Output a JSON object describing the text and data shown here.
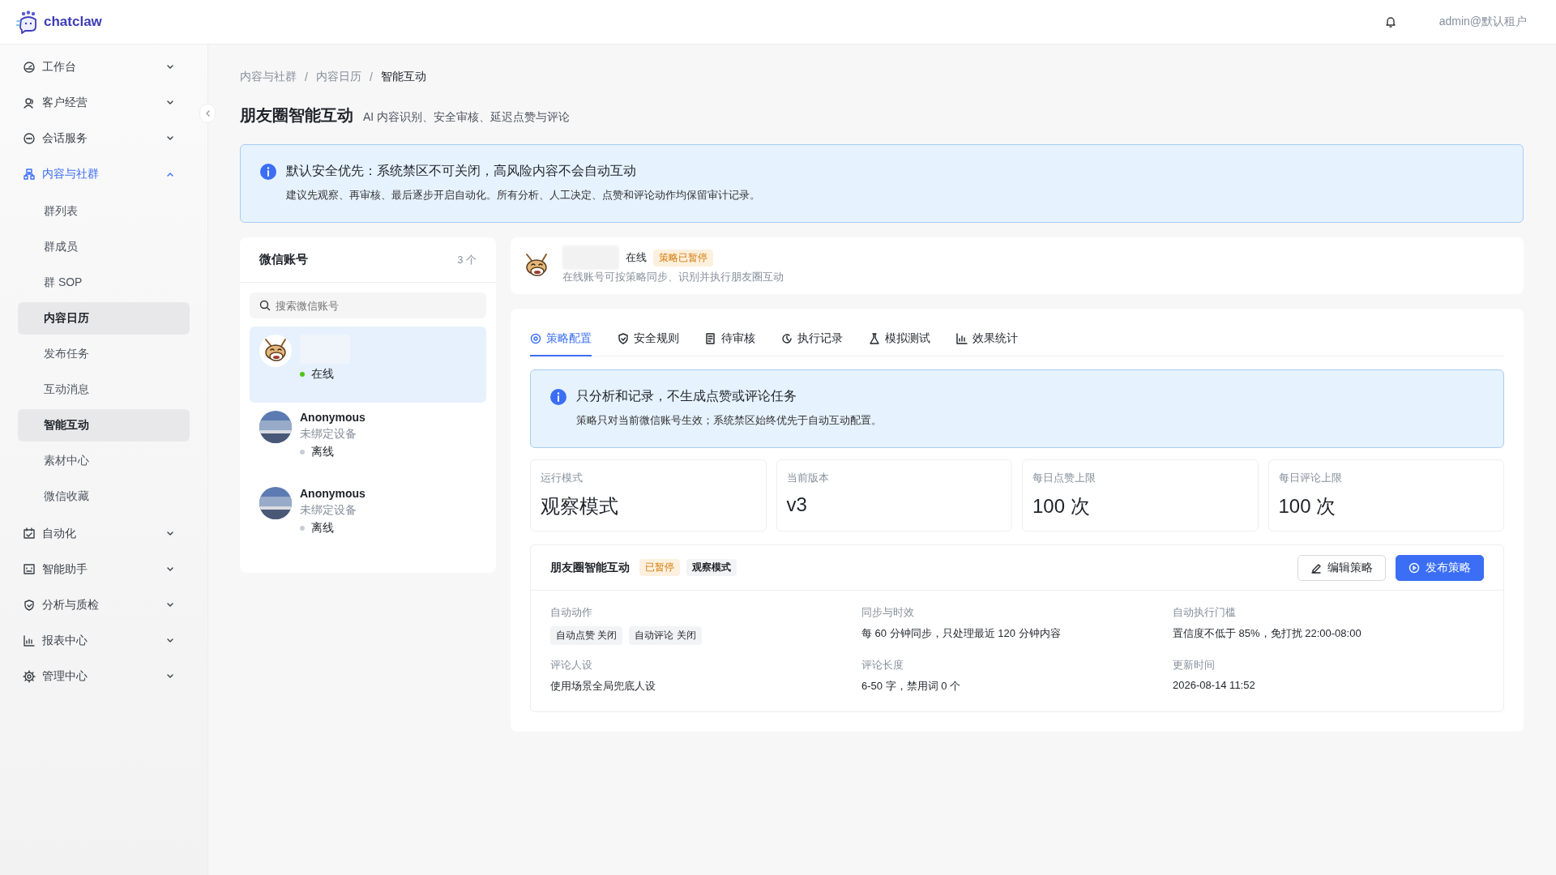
{
  "header": {
    "brand": "chatclaw",
    "user": "admin@默认租户"
  },
  "sidebar": {
    "items": [
      {
        "label": "工作台",
        "expanded": false,
        "active": false
      },
      {
        "label": "客户经营",
        "expanded": false,
        "active": false
      },
      {
        "label": "会话服务",
        "expanded": false,
        "active": false
      },
      {
        "label": "内容与社群",
        "expanded": true,
        "active": true,
        "children": [
          {
            "label": "群列表",
            "selected": false
          },
          {
            "label": "群成员",
            "selected": false
          },
          {
            "label": "群 SOP",
            "selected": false
          },
          {
            "label": "内容日历",
            "selected": true
          },
          {
            "label": "发布任务",
            "selected": false
          },
          {
            "label": "互动消息",
            "selected": false
          },
          {
            "label": "智能互动",
            "selected": true
          },
          {
            "label": "素材中心",
            "selected": false
          },
          {
            "label": "微信收藏",
            "selected": false
          }
        ]
      },
      {
        "label": "自动化",
        "expanded": false,
        "active": false
      },
      {
        "label": "智能助手",
        "expanded": false,
        "active": false
      },
      {
        "label": "分析与质检",
        "expanded": false,
        "active": false
      },
      {
        "label": "报表中心",
        "expanded": false,
        "active": false
      },
      {
        "label": "管理中心",
        "expanded": false,
        "active": false
      }
    ]
  },
  "breadcrumb": {
    "separator": "/",
    "items": [
      "内容与社群",
      "内容日历",
      "智能互动"
    ]
  },
  "page": {
    "title": "朋友圈智能互动",
    "subtitle": "AI 内容识别、安全审核、延迟点赞与评论"
  },
  "notice": {
    "title": "默认安全优先：系统禁区不可关闭，高风险内容不会自动互动",
    "text": "建议先观察、再审核、最后逐步开启自动化。所有分析、人工决定、点赞和评论动作均保留审计记录。"
  },
  "accounts": {
    "title": "微信账号",
    "count": "3 个",
    "search": {
      "placeholder": "搜索微信账号"
    },
    "items": [
      {
        "status": "在线",
        "online": true,
        "selected": true
      },
      {
        "name": "Anonymous",
        "device": "未绑定设备",
        "status": "离线",
        "online": false,
        "selected": false
      },
      {
        "name": "Anonymous",
        "device": "未绑定设备",
        "status": "离线",
        "online": false,
        "selected": false
      }
    ]
  },
  "account_card": {
    "status": "在线",
    "badge": "策略已暂停",
    "text": "在线账号可按策略同步、识别并执行朋友圈互动"
  },
  "tabs": [
    {
      "label": "策略配置",
      "selected": true
    },
    {
      "label": "安全规则",
      "selected": false
    },
    {
      "label": "待审核",
      "selected": false
    },
    {
      "label": "执行记录",
      "selected": false
    },
    {
      "label": "模拟测试",
      "selected": false
    },
    {
      "label": "效果统计",
      "selected": false
    }
  ],
  "mode_notice": {
    "title": "只分析和记录，不生成点赞或评论任务",
    "text": "策略只对当前微信账号生效；系统禁区始终优先于自动互动配置。"
  },
  "stats": [
    {
      "label": "运行模式",
      "value": "观察模式"
    },
    {
      "label": "当前版本",
      "value": "v3"
    },
    {
      "label": "每日点赞上限",
      "value": "100 次"
    },
    {
      "label": "每日评论上限",
      "value": "100 次"
    }
  ],
  "strategy": {
    "title": "朋友圈智能互动",
    "tags": [
      {
        "label": "已暂停",
        "kind": "warning"
      },
      {
        "label": "观察模式",
        "kind": "neutral"
      }
    ],
    "buttons": [
      {
        "label": "编辑策略",
        "kind": "secondary"
      },
      {
        "label": "发布策略",
        "kind": "primary"
      }
    ],
    "fields": [
      {
        "label": "自动动作",
        "chips": [
          "自动点赞 关闭",
          "自动评论 关闭"
        ]
      },
      {
        "label": "同步与时效",
        "value": "每 60 分钟同步，只处理最近 120 分钟内容"
      },
      {
        "label": "自动执行门槛",
        "value": "置信度不低于 85%，免打扰 22:00-08:00"
      },
      {
        "label": "评论人设",
        "value": "使用场景全局兜底人设"
      },
      {
        "label": "评论长度",
        "value": "6-50 字，禁用词 0 个"
      },
      {
        "label": "更新时间",
        "value": "2026-08-14 11:52"
      }
    ]
  }
}
